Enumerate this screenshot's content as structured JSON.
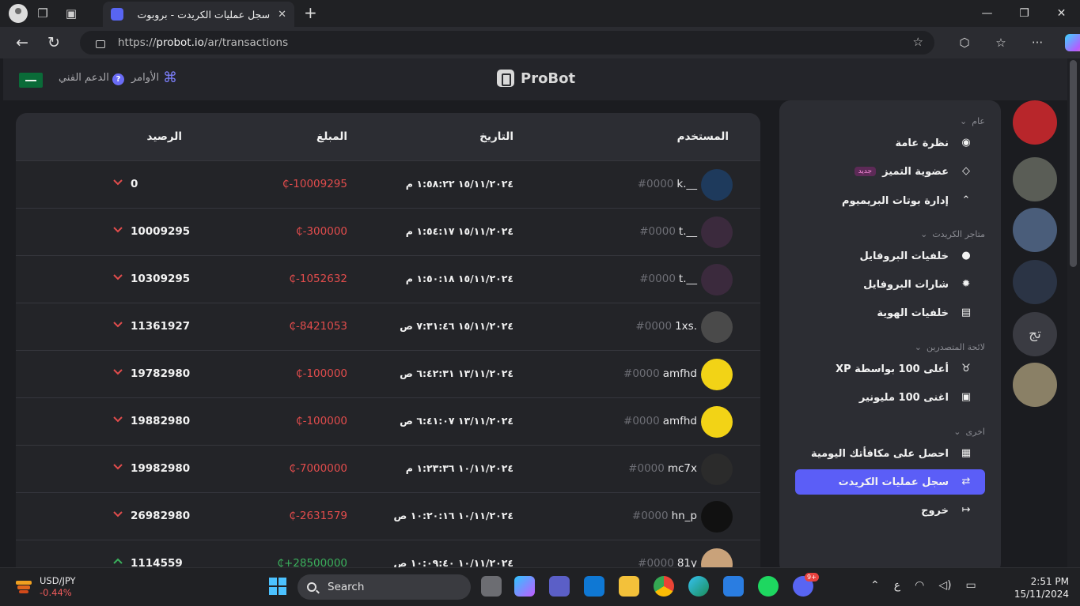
{
  "browser": {
    "tab_title": "سجل عمليات الكريدت - بروبوت",
    "url_prefix": "https://",
    "url_host": "probot.io",
    "url_path": "/ar/transactions"
  },
  "header": {
    "brand": "ProBot",
    "support_label": "الدعم الفني",
    "commands_label": "الأوامر"
  },
  "table": {
    "headers": {
      "user": "المستخدم",
      "date": "التاريخ",
      "amount": "المبلغ",
      "balance": "الرصيد"
    },
    "currency_symbol": "₵",
    "rows": [
      {
        "user": "k.__",
        "tag": "#0000",
        "date": "١٥/١١/٢٠٢٤ ١:٥٨:٢٢ م",
        "amount": "-10009295",
        "balance": "0",
        "direction": "down",
        "avatar_color": "#1e3a5c"
      },
      {
        "user": "t.__",
        "tag": "#0000",
        "date": "١٥/١١/٢٠٢٤ ١:٥٤:١٧ م",
        "amount": "-300000",
        "balance": "10009295",
        "direction": "down",
        "avatar_color": "#3b2a3d"
      },
      {
        "user": "t.__",
        "tag": "#0000",
        "date": "١٥/١١/٢٠٢٤ ١:٥٠:١٨ م",
        "amount": "-1052632",
        "balance": "10309295",
        "direction": "down",
        "avatar_color": "#3b2a3d"
      },
      {
        "user": "1xs.",
        "tag": "#0000",
        "date": "١٥/١١/٢٠٢٤ ٧:٣١:٤٦ ص",
        "amount": "-8421053",
        "balance": "11361927",
        "direction": "down",
        "avatar_color": "#4a4a4a"
      },
      {
        "user": "amfhd",
        "tag": "#0000",
        "date": "١٣/١١/٢٠٢٤ ٦:٤٢:٣١ ص",
        "amount": "-100000",
        "balance": "19782980",
        "direction": "down",
        "avatar_color": "#f2d316"
      },
      {
        "user": "amfhd",
        "tag": "#0000",
        "date": "١٣/١١/٢٠٢٤ ٦:٤١:٠٧ ص",
        "amount": "-100000",
        "balance": "19882980",
        "direction": "down",
        "avatar_color": "#f2d316"
      },
      {
        "user": "mc7x",
        "tag": "#0000",
        "date": "١٠/١١/٢٠٢٤ ١:٢٣:٣٦ م",
        "amount": "-7000000",
        "balance": "19982980",
        "direction": "down",
        "avatar_color": "#2b2b2b"
      },
      {
        "user": "hn_p",
        "tag": "#0000",
        "date": "١٠/١١/٢٠٢٤ ١٠:٢٠:١٦ ص",
        "amount": "-2631579",
        "balance": "26982980",
        "direction": "down",
        "avatar_color": "#111111"
      },
      {
        "user": "81y",
        "tag": "#0000",
        "date": "١٠/١١/٢٠٢٤ ١٠:٠٩:٤٠ ص",
        "amount": "+28500000",
        "balance": "1114559",
        "direction": "up",
        "avatar_color": "#c9a27a"
      }
    ]
  },
  "sidebar": {
    "sections": [
      {
        "title": "عام",
        "items": [
          {
            "label": "نظرة عامة",
            "icon": "eye-icon",
            "glyph": "◉"
          },
          {
            "label": "عضوية التميز",
            "icon": "diamond-icon",
            "glyph": "◇",
            "badge": "جديد"
          },
          {
            "label": "إدارة بوتات البريميوم",
            "icon": "chevron-up-circle-icon",
            "glyph": "⌃"
          }
        ]
      },
      {
        "title": "متاجر الكريدت",
        "items": [
          {
            "label": "خلفيات البروفايل",
            "icon": "user-circle-icon",
            "glyph": "●"
          },
          {
            "label": "شارات البروفايل",
            "icon": "badge-icon",
            "glyph": "✹"
          },
          {
            "label": "خلفيات الهوية",
            "icon": "id-card-icon",
            "glyph": "▤"
          }
        ]
      },
      {
        "title": "لائحة المتصدرين",
        "items": [
          {
            "label": "أعلى 100 بواسطة XP",
            "icon": "medal-icon",
            "glyph": "♉"
          },
          {
            "label": "اغنى 100 مليونير",
            "icon": "money-icon",
            "glyph": "▣"
          }
        ]
      },
      {
        "title": "اخرى",
        "items": [
          {
            "label": "احصل على مكافأتك اليومية",
            "icon": "gift-icon",
            "glyph": "▦"
          },
          {
            "label": "سجل عمليات الكريدت",
            "icon": "transfer-icon",
            "glyph": "⇄",
            "active": true
          },
          {
            "label": "خروج",
            "icon": "logout-icon",
            "glyph": "↦"
          }
        ]
      }
    ]
  },
  "servers": [
    {
      "name": "server-1",
      "color": "#b8262b",
      "text": ""
    },
    {
      "name": "server-2",
      "color": "#5a5d56",
      "text": ""
    },
    {
      "name": "server-3",
      "color": "#4a5d7a",
      "text": ""
    },
    {
      "name": "server-4",
      "color": "#2b3445",
      "text": ""
    },
    {
      "name": "server-5",
      "color": "#3a3b42",
      "text": "تج"
    },
    {
      "name": "server-6",
      "color": "#8a8066",
      "text": ""
    }
  ],
  "taskbar": {
    "ticker_name": "USD/JPY",
    "ticker_change": "-0.44%",
    "search_label": "Search",
    "time": "2:51 PM",
    "date": "15/11/2024",
    "lang": "ع",
    "discord_badge": "9+"
  }
}
